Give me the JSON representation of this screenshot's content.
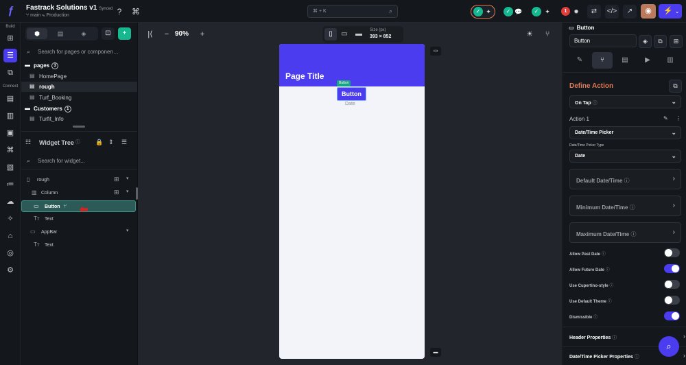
{
  "topbar": {
    "project_title": "Fastrack Solutions v1",
    "synced": "Synced",
    "branch": "main",
    "environment": "Production",
    "search_shortcut": "⌘ + K",
    "error_count": "1"
  },
  "left_panel": {
    "search_pages_placeholder": "Search for pages or componen…",
    "tree": [
      {
        "label": "pages",
        "type": "folder",
        "count": "3"
      },
      {
        "label": "HomePage",
        "type": "page"
      },
      {
        "label": "rough",
        "type": "page",
        "selected": true
      },
      {
        "label": "Turf_Booking",
        "type": "page"
      },
      {
        "label": "Customers",
        "type": "folder",
        "count": "1"
      },
      {
        "label": "Turfit_Info",
        "type": "page"
      }
    ],
    "widget_tree_title": "Widget Tree",
    "search_widget_placeholder": "Search for widget...",
    "widgets": [
      {
        "label": "rough"
      },
      {
        "label": "Column"
      },
      {
        "label": "Button",
        "selected": true
      },
      {
        "label": "Text"
      },
      {
        "label": "AppBar"
      },
      {
        "label": "Text"
      }
    ]
  },
  "rail": {
    "build_label": "Build",
    "connect_label": "Connect"
  },
  "canvas": {
    "zoom": "90%",
    "size_label": "Size (px)",
    "size_value": "393 × 852",
    "page_title": "Page Title",
    "button_tag": "Button",
    "button_label": "Button",
    "text_label": "Date"
  },
  "right_panel": {
    "widget_name": "Button",
    "name_value": "Button",
    "define_action": "Define Action",
    "trigger": "On Tap",
    "action_label": "Action 1",
    "action_type": "Date/Time Picker",
    "picker_type_label": "Date/Time Picker Type",
    "picker_type_value": "Date",
    "option_cards": [
      "Default Date/Time",
      "Minimum Date/Time",
      "Maximum Date/Time"
    ],
    "toggles": [
      {
        "label": "Allow Past Date",
        "on": false
      },
      {
        "label": "Allow Future Date",
        "on": true
      },
      {
        "label": "Use Cupertino-style",
        "on": false
      },
      {
        "label": "Use Default Theme",
        "on": false
      },
      {
        "label": "Dismissible",
        "on": true
      }
    ],
    "sections": [
      "Header Properties",
      "Date/Time Picker Properties"
    ]
  },
  "colors": {
    "accent": "#4b3cf0",
    "define_action": "#e07b57",
    "selected_widget": "#2c5a57",
    "success": "#17b890",
    "error": "#e13c3c"
  }
}
